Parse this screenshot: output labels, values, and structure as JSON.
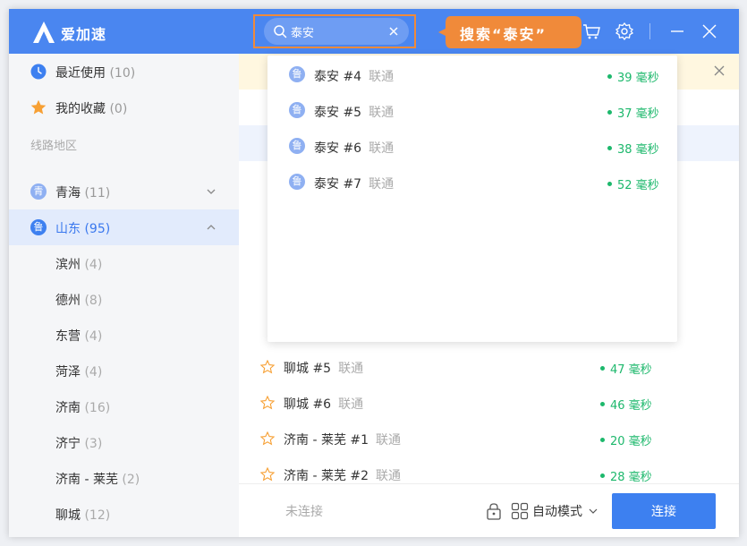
{
  "app": {
    "name": "爱加速"
  },
  "search": {
    "value": "泰安"
  },
  "callout": {
    "text": "搜索“泰安”"
  },
  "sidebar": {
    "recent": {
      "label": "最近使用",
      "count": "(10)"
    },
    "favorites": {
      "label": "我的收藏",
      "count": "(0)"
    },
    "section": "线路地区",
    "qinghai": {
      "label": "青海",
      "count": "(11)",
      "badge": "青"
    },
    "shandong": {
      "label": "山东",
      "count": "(95)",
      "badge": "鲁"
    },
    "cities": [
      {
        "label": "滨州",
        "count": "(4)"
      },
      {
        "label": "德州",
        "count": "(8)"
      },
      {
        "label": "东营",
        "count": "(4)"
      },
      {
        "label": "菏泽",
        "count": "(4)"
      },
      {
        "label": "济南",
        "count": "(16)"
      },
      {
        "label": "济宁",
        "count": "(3)"
      },
      {
        "label": "济南 - 莱芜",
        "count": "(2)"
      },
      {
        "label": "聊城",
        "count": "(12)"
      }
    ]
  },
  "list": [
    {
      "name": "聊城 #5",
      "isp": "联通",
      "latency": "47 毫秒"
    },
    {
      "name": "聊城 #6",
      "isp": "联通",
      "latency": "46 毫秒"
    },
    {
      "name": "济南 - 莱芜 #1",
      "isp": "联通",
      "latency": "20 毫秒"
    },
    {
      "name": "济南 - 莱芜 #2",
      "isp": "联通",
      "latency": "28 毫秒"
    }
  ],
  "dropdown": [
    {
      "badge": "鲁",
      "name": "泰安 #4",
      "isp": "联通",
      "latency": "39 毫秒"
    },
    {
      "badge": "鲁",
      "name": "泰安 #5",
      "isp": "联通",
      "latency": "37 毫秒"
    },
    {
      "badge": "鲁",
      "name": "泰安 #6",
      "isp": "联通",
      "latency": "38 毫秒"
    },
    {
      "badge": "鲁",
      "name": "泰安 #7",
      "isp": "联通",
      "latency": "52 毫秒"
    }
  ],
  "footer": {
    "status": "未连接",
    "mode": "自动模式",
    "connect": "连接"
  },
  "colors": {
    "brand": "#4a86f0",
    "highlight": "#f08a3a",
    "latency": "#1db86c"
  }
}
